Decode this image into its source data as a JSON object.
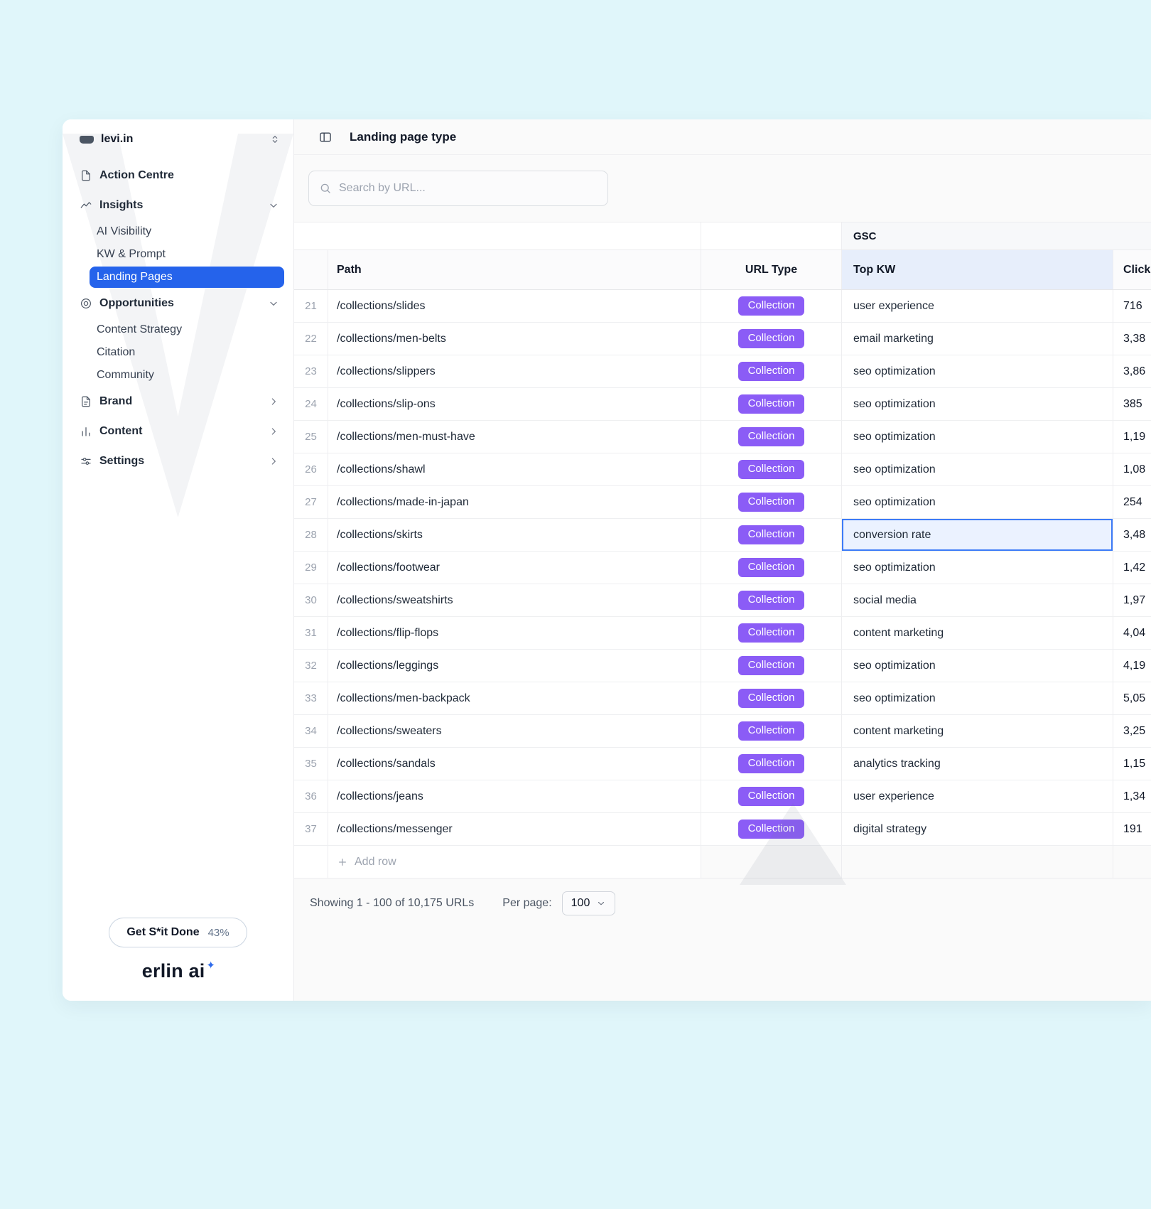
{
  "colors": {
    "canvas_bg": "#e0f6fa",
    "accent_blue": "#2563eb",
    "badge_purple": "#8b5cf6",
    "selected_cell_border": "#3d7bf7",
    "kw_header_bg": "#e7eefb",
    "sparkle_blue": "#2f6beb"
  },
  "icons": {
    "workspace_logo": "levis-logo-mark",
    "workspace_selector": "chevron-up-down-icon",
    "action_centre": "clipboard-icon",
    "insights": "trend-line-icon",
    "opportunities": "target-icon",
    "brand": "document-icon",
    "content": "bar-chart-icon",
    "settings": "sliders-icon",
    "expanded_section": "chevron-down-icon",
    "collapsed_section": "chevron-right-icon",
    "panel_toggle": "sidebar-toggle-icon",
    "search": "search-icon",
    "add_row": "plus-icon",
    "per_page": "chevron-down-icon",
    "logo_sparkle": "sparkle-icon"
  },
  "sidebar": {
    "workspace": "levi.in",
    "nav": {
      "action_centre": "Action Centre",
      "insights": "Insights",
      "ai_visibility": "AI Visibility",
      "kw_prompt": "KW & Prompt",
      "landing_pages": "Landing Pages",
      "opportunities": "Opportunities",
      "content_strategy": "Content Strategy",
      "citation": "Citation",
      "community": "Community",
      "brand": "Brand",
      "content": "Content",
      "settings": "Settings"
    },
    "cta": {
      "label": "Get S*it Done",
      "percent": "43%"
    },
    "logo": "erlin ai"
  },
  "header": {
    "title": "Landing page type",
    "search_placeholder": "Search by URL..."
  },
  "table": {
    "group_header": "GSC",
    "columns": {
      "path": "Path",
      "url_type": "URL Type",
      "top_kw": "Top KW",
      "clicks": "Clicks"
    },
    "add_row_label": "Add row",
    "rows": [
      {
        "num": "21",
        "path": "/collections/slides",
        "url_type": "Collection",
        "top_kw": "user experience",
        "clicks": "716",
        "selected": false
      },
      {
        "num": "22",
        "path": "/collections/men-belts",
        "url_type": "Collection",
        "top_kw": "email marketing",
        "clicks": "3,38",
        "selected": false
      },
      {
        "num": "23",
        "path": "/collections/slippers",
        "url_type": "Collection",
        "top_kw": "seo optimization",
        "clicks": "3,86",
        "selected": false
      },
      {
        "num": "24",
        "path": "/collections/slip-ons",
        "url_type": "Collection",
        "top_kw": "seo optimization",
        "clicks": "385",
        "selected": false
      },
      {
        "num": "25",
        "path": "/collections/men-must-have",
        "url_type": "Collection",
        "top_kw": "seo optimization",
        "clicks": "1,19",
        "selected": false
      },
      {
        "num": "26",
        "path": "/collections/shawl",
        "url_type": "Collection",
        "top_kw": "seo optimization",
        "clicks": "1,08",
        "selected": false
      },
      {
        "num": "27",
        "path": "/collections/made-in-japan",
        "url_type": "Collection",
        "top_kw": "seo optimization",
        "clicks": "254",
        "selected": false
      },
      {
        "num": "28",
        "path": "/collections/skirts",
        "url_type": "Collection",
        "top_kw": "conversion rate",
        "clicks": "3,48",
        "selected": true
      },
      {
        "num": "29",
        "path": "/collections/footwear",
        "url_type": "Collection",
        "top_kw": "seo optimization",
        "clicks": "1,42",
        "selected": false
      },
      {
        "num": "30",
        "path": "/collections/sweatshirts",
        "url_type": "Collection",
        "top_kw": "social media",
        "clicks": "1,97",
        "selected": false
      },
      {
        "num": "31",
        "path": "/collections/flip-flops",
        "url_type": "Collection",
        "top_kw": "content marketing",
        "clicks": "4,04",
        "selected": false
      },
      {
        "num": "32",
        "path": "/collections/leggings",
        "url_type": "Collection",
        "top_kw": "seo optimization",
        "clicks": "4,19",
        "selected": false
      },
      {
        "num": "33",
        "path": "/collections/men-backpack",
        "url_type": "Collection",
        "top_kw": "seo optimization",
        "clicks": "5,05",
        "selected": false
      },
      {
        "num": "34",
        "path": "/collections/sweaters",
        "url_type": "Collection",
        "top_kw": "content marketing",
        "clicks": "3,25",
        "selected": false
      },
      {
        "num": "35",
        "path": "/collections/sandals",
        "url_type": "Collection",
        "top_kw": "analytics tracking",
        "clicks": "1,15",
        "selected": false
      },
      {
        "num": "36",
        "path": "/collections/jeans",
        "url_type": "Collection",
        "top_kw": "user experience",
        "clicks": "1,34",
        "selected": false
      },
      {
        "num": "37",
        "path": "/collections/messenger",
        "url_type": "Collection",
        "top_kw": "digital strategy",
        "clicks": "191",
        "selected": false
      }
    ]
  },
  "pagination": {
    "showing": "Showing 1 - 100 of 10,175 URLs",
    "per_page_label": "Per page:",
    "per_page_value": "100"
  }
}
